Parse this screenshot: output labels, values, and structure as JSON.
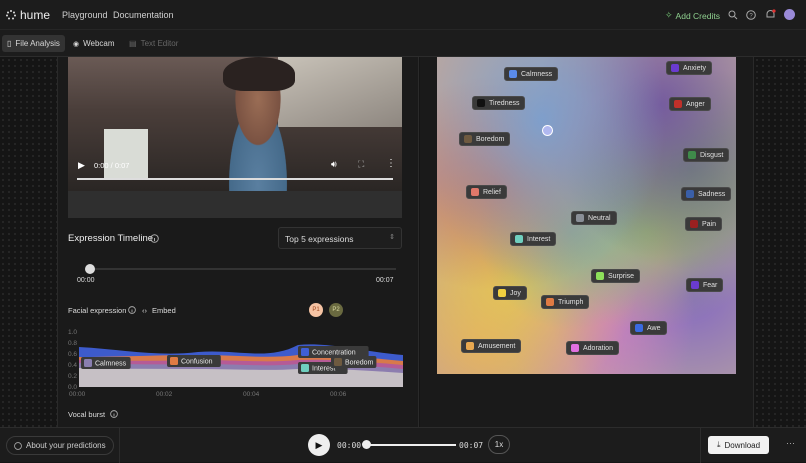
{
  "header": {
    "brand": "hume",
    "nav": [
      "Playground",
      "Documentation"
    ],
    "add_credits": "Add Credits"
  },
  "tabs": [
    {
      "label": "File Analysis",
      "active": true
    },
    {
      "label": "Webcam",
      "active": false
    },
    {
      "label": "Text Editor",
      "active": false
    }
  ],
  "video": {
    "time": "0:00 / 0:07",
    "progress": 0.0
  },
  "timeline": {
    "title": "Expression Timeline",
    "select": "Top 5 expressions",
    "start": "00:00",
    "end": "00:07"
  },
  "facial": {
    "label": "Facial expression",
    "embed": "Embed",
    "badges": [
      "P1",
      "P2"
    ]
  },
  "chart_data": {
    "type": "area",
    "y_ticks": [
      "1.0",
      "0.8",
      "0.6",
      "0.4",
      "0.2",
      "0.0"
    ],
    "x_ticks": [
      "00:00",
      "00:02",
      "00:04",
      "00:06"
    ],
    "ylim": [
      0,
      1
    ],
    "legend_labels": [
      "Calmness",
      "Confusion",
      "Concentration",
      "Interest",
      "Boredom"
    ],
    "series": [
      {
        "name": "Calmness",
        "color": "#8a7fb0"
      },
      {
        "name": "Confusion",
        "color": "#e07b43"
      },
      {
        "name": "Concentration",
        "color": "#3f5fd6"
      },
      {
        "name": "Interest",
        "color": "#6fcfbf"
      },
      {
        "name": "Boredom",
        "color": "#6e5a40"
      }
    ]
  },
  "vocal": {
    "label": "Vocal burst"
  },
  "map_labels": [
    {
      "text": "Calmness",
      "color": "#5a8bea"
    },
    {
      "text": "Anxiety",
      "color": "#6a3bd0"
    },
    {
      "text": "Tiredness",
      "color": "#111111"
    },
    {
      "text": "Anger",
      "color": "#c0302a"
    },
    {
      "text": "Boredom",
      "color": "#6e5a40"
    },
    {
      "text": "Disgust",
      "color": "#3f8a4a"
    },
    {
      "text": "Relief",
      "color": "#e0786a"
    },
    {
      "text": "Sadness",
      "color": "#3a5fa8"
    },
    {
      "text": "Neutral",
      "color": "#8a8f97"
    },
    {
      "text": "Pain",
      "color": "#9a2020"
    },
    {
      "text": "Interest",
      "color": "#6fcfbf"
    },
    {
      "text": "Surprise",
      "color": "#8de05a"
    },
    {
      "text": "Fear",
      "color": "#6a3bd0"
    },
    {
      "text": "Joy",
      "color": "#f0d040"
    },
    {
      "text": "Triumph",
      "color": "#e07b43"
    },
    {
      "text": "Awe",
      "color": "#3a6ae0"
    },
    {
      "text": "Amusement",
      "color": "#e8a850"
    },
    {
      "text": "Adoration",
      "color": "#e070e0"
    }
  ],
  "footer": {
    "about": "About your predictions",
    "time_now": "00:00",
    "time_end": "00:07",
    "speed": "1x",
    "download": "Download",
    "progress": 0.0
  }
}
